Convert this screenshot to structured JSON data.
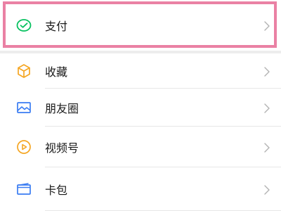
{
  "menu": {
    "items": [
      {
        "label": "支付",
        "icon": "wechat-pay-icon",
        "icon_color": "#07c160"
      },
      {
        "label": "收藏",
        "icon": "favorites-cube-icon",
        "icon_color": "#f5a623"
      },
      {
        "label": "朋友圈",
        "icon": "moments-picture-icon",
        "icon_color": "#3a7cf2"
      },
      {
        "label": "视频号",
        "icon": "channels-play-icon",
        "icon_color": "#f5a623"
      },
      {
        "label": "卡包",
        "icon": "card-wallet-icon",
        "icon_color": "#3a7cf2"
      }
    ]
  },
  "highlight": {
    "target": "支付",
    "color": "#ea81a4"
  }
}
